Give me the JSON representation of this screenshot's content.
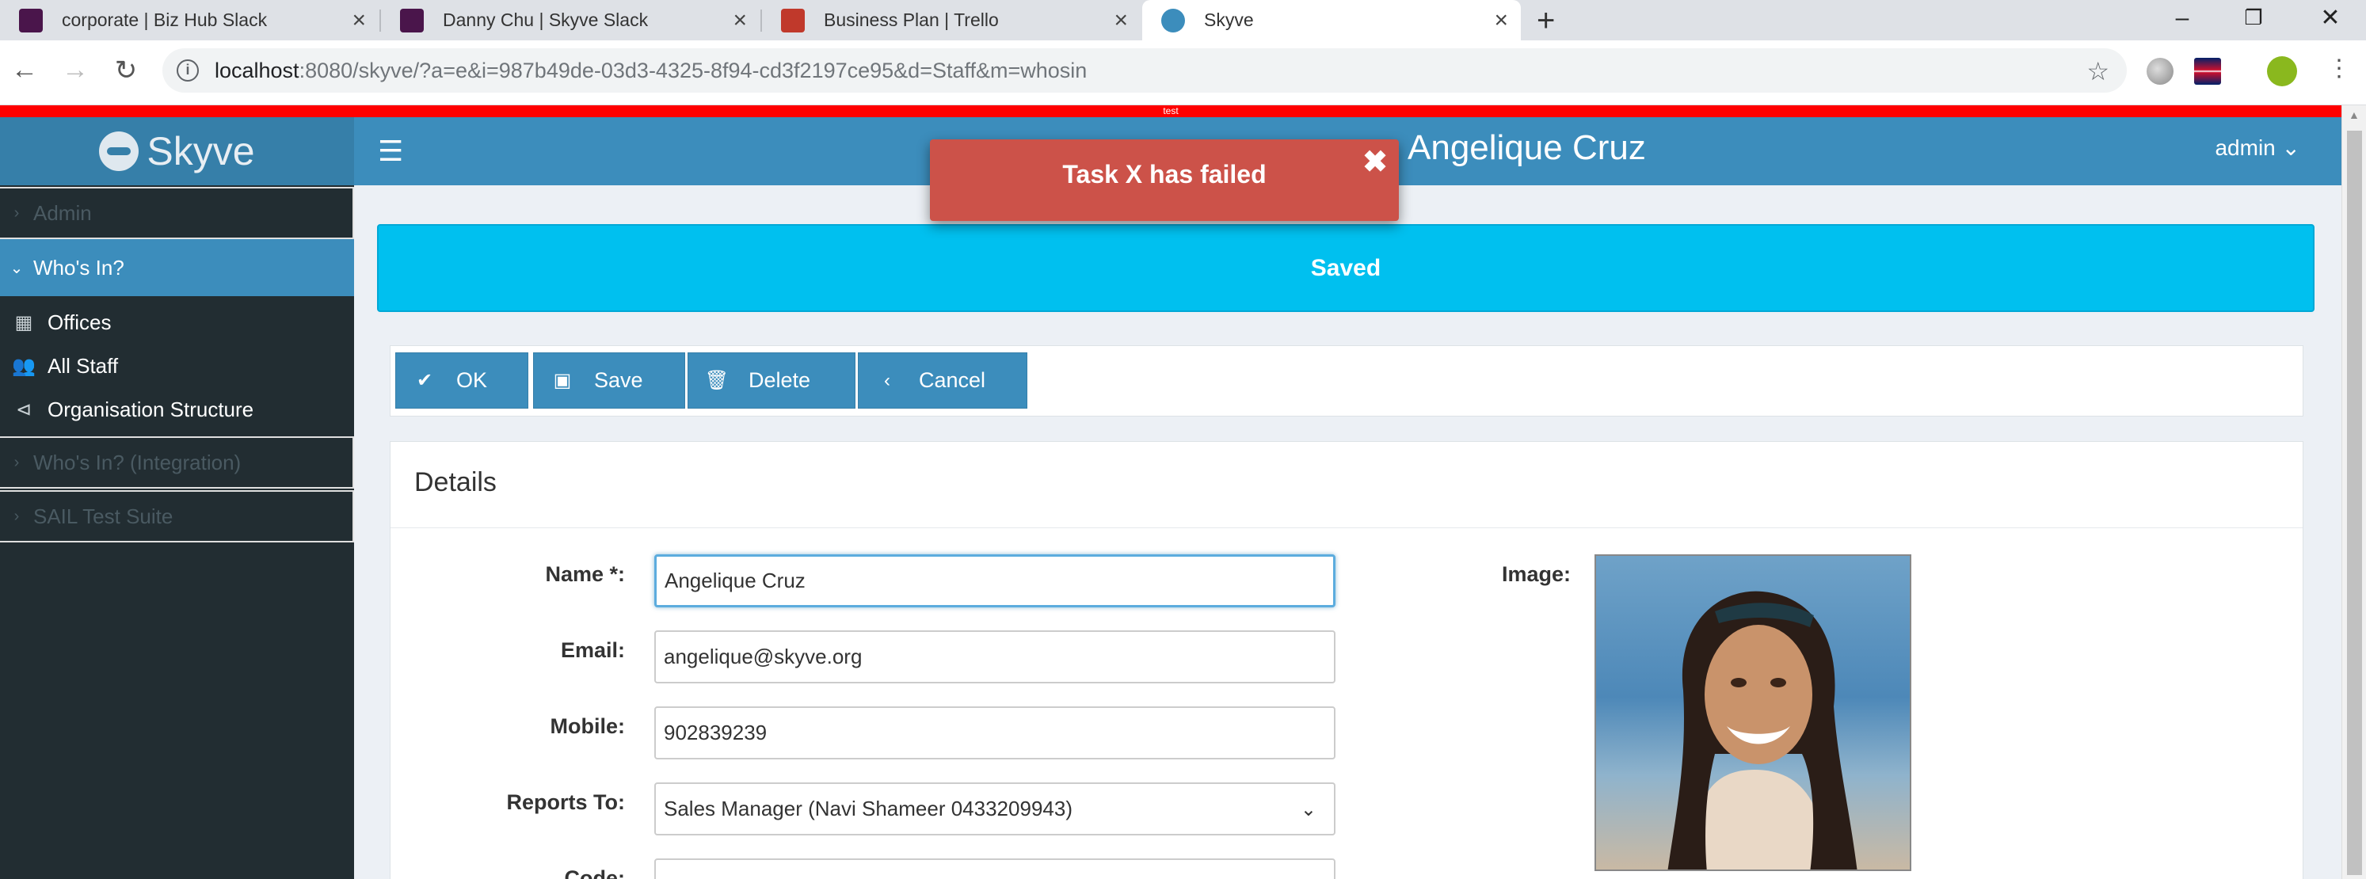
{
  "browser": {
    "tabs": [
      {
        "label": "corporate | Biz Hub Slack",
        "favicon_color": "#4a154b"
      },
      {
        "label": "Danny Chu | Skyve Slack",
        "favicon_color": "#4a154b"
      },
      {
        "label": "Business Plan | Trello",
        "favicon_color": "#c0392b"
      },
      {
        "label": "Skyve",
        "favicon_color": "#3c8dbc"
      }
    ],
    "url_host": "localhost",
    "url_rest": ":8080/skyve/?a=e&i=987b49de-03d3-4325-8f94-cd3f2197ce95&d=Staff&m=whosin"
  },
  "app": {
    "test_banner": "test",
    "logo_text": "Skyve",
    "title": "Angelique Cruz",
    "user_menu": "admin",
    "sidebar": {
      "groups": [
        {
          "label": "Admin",
          "open": false
        },
        {
          "label": "Who's In?",
          "open": true
        },
        {
          "label": "Who's In? (Integration)",
          "open": false
        },
        {
          "label": "SAIL Test Suite",
          "open": false
        }
      ],
      "items": [
        {
          "label": "Offices",
          "icon": "building-icon"
        },
        {
          "label": "All Staff",
          "icon": "users-icon"
        },
        {
          "label": "Organisation Structure",
          "icon": "share-icon"
        }
      ]
    },
    "notification": {
      "message": "Task X has failed"
    },
    "status_banner": "Saved",
    "actions": {
      "ok": "OK",
      "save": "Save",
      "delete": "Delete",
      "cancel": "Cancel"
    },
    "details": {
      "title": "Details",
      "fields": {
        "name": {
          "label": "Name *:",
          "value": "Angelique Cruz"
        },
        "email": {
          "label": "Email:",
          "value": "angelique@skyve.org"
        },
        "mobile": {
          "label": "Mobile:",
          "value": "902839239"
        },
        "reports_to": {
          "label": "Reports To:",
          "value": "Sales Manager (Navi Shameer 0433209943)"
        },
        "code": {
          "label": "Code:",
          "value": ""
        }
      },
      "image_label": "Image:"
    }
  },
  "colors": {
    "header": "#3c8dbc",
    "sidebar": "#222d32",
    "notification": "#cc5249",
    "saved_banner": "#00c0ef",
    "test_bar": "#ff0000"
  }
}
